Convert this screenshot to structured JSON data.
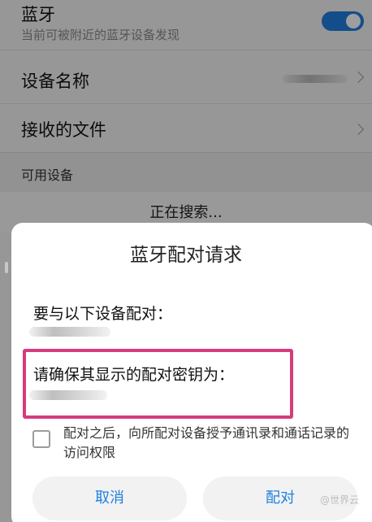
{
  "settings": {
    "bluetooth": {
      "title": "蓝牙",
      "subtitle": "当前可被附近的蓝牙设备发现",
      "enabled": true,
      "accent_color": "#1f7fe0"
    },
    "device_name": {
      "label": "设备名称"
    },
    "received_files": {
      "label": "接收的文件"
    },
    "available_devices_header": "可用设备",
    "searching_text": "正在搜索..."
  },
  "dialog": {
    "title": "蓝牙配对请求",
    "prompt": "要与以下设备配对：",
    "confirm_text": "请确保其显示的配对密钥为：",
    "consent_text": "配对之后，向所配对设备授予通讯录和通话记录的访问权限",
    "consent_checked": false,
    "cancel_label": "取消",
    "pair_label": "配对",
    "highlight_color": "#d63b7d"
  },
  "watermark": "@世界云"
}
